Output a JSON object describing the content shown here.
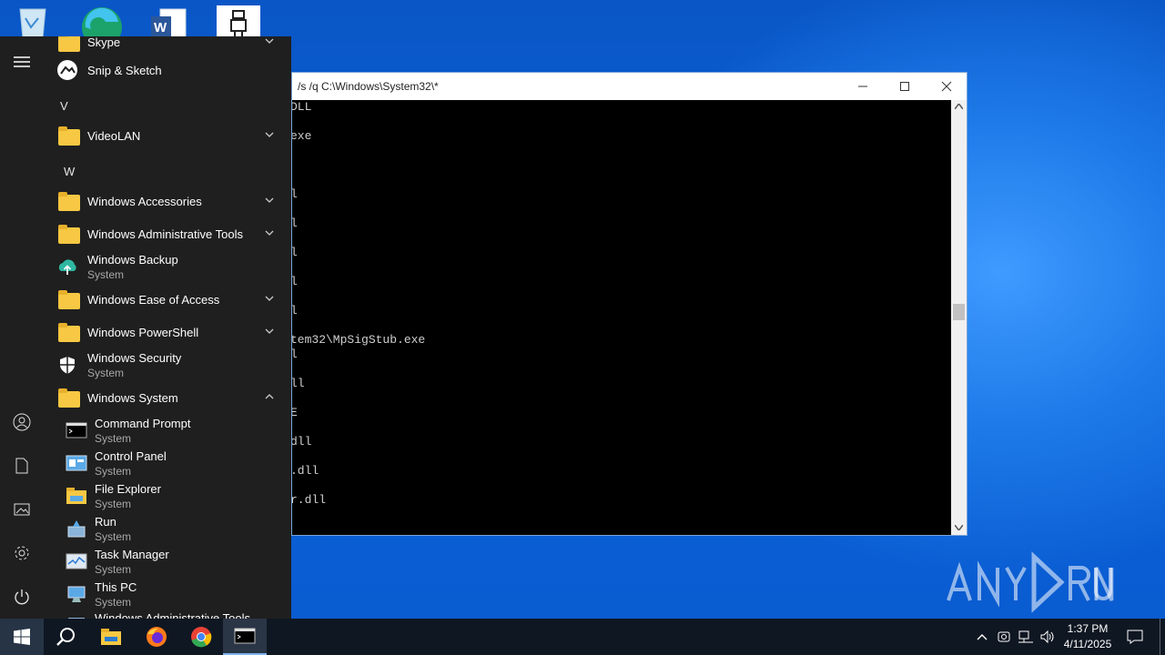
{
  "desktop": {
    "icons": [
      "recycle-bin",
      "edge",
      "word",
      "app-tile"
    ]
  },
  "cmd_window": {
    "title": "/s /q C:\\Windows\\System32\\*",
    "lines": [
      "DLL",
      "exe",
      "l",
      "l",
      "l",
      "l",
      "l",
      "tem32\\MpSigStub.exe",
      "l",
      "ll",
      "E",
      "dll",
      ".dll",
      "r.dll"
    ]
  },
  "start_menu": {
    "rail": [
      "menu-icon",
      "user-icon",
      "documents-icon",
      "pictures-icon",
      "settings-icon",
      "power-icon"
    ],
    "items": {
      "skype": {
        "label": "Skype"
      },
      "snip": {
        "label": "Snip & Sketch"
      },
      "letter_v": "V",
      "videolan": {
        "label": "VideoLAN"
      },
      "letter_w": "W",
      "accessories": {
        "label": "Windows Accessories"
      },
      "admin_tools": {
        "label": "Windows Administrative Tools"
      },
      "backup": {
        "label": "Windows Backup",
        "sub": "System"
      },
      "ease": {
        "label": "Windows Ease of Access"
      },
      "powershell": {
        "label": "Windows PowerShell"
      },
      "security": {
        "label": "Windows Security",
        "sub": "System"
      },
      "system": {
        "label": "Windows System"
      },
      "cmd": {
        "label": "Command Prompt",
        "sub": "System"
      },
      "control_panel": {
        "label": "Control Panel",
        "sub": "System"
      },
      "explorer": {
        "label": "File Explorer",
        "sub": "System"
      },
      "run": {
        "label": "Run",
        "sub": "System"
      },
      "task_manager": {
        "label": "Task Manager",
        "sub": "System"
      },
      "this_pc": {
        "label": "This PC",
        "sub": "System"
      },
      "cut_item": {
        "label": "Windows Administrative Tools"
      }
    }
  },
  "taskbar": {
    "time": "1:37 PM",
    "date": "4/11/2025"
  },
  "watermark": {
    "text": "ANY RUN"
  }
}
